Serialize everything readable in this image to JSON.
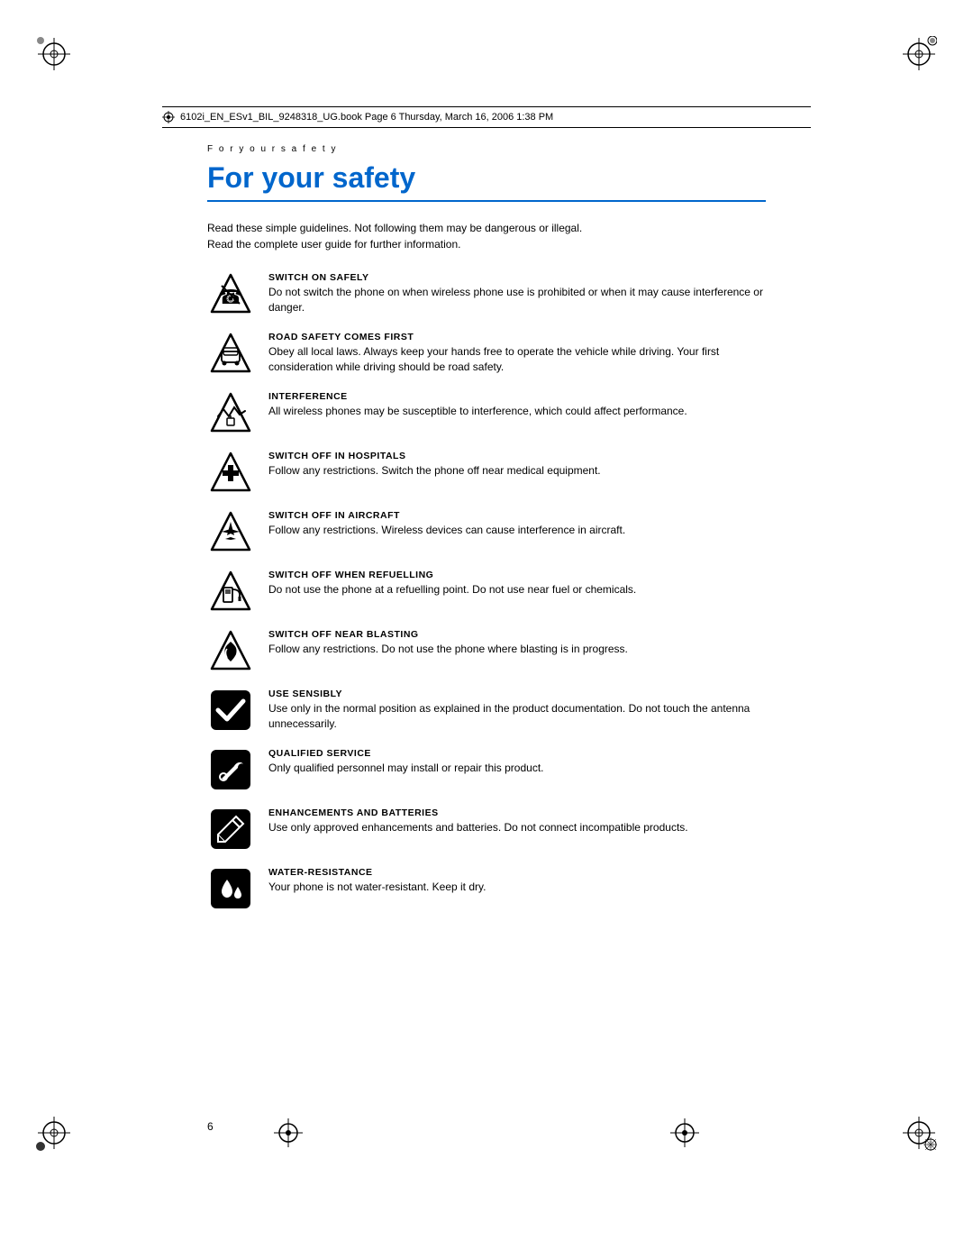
{
  "header": {
    "text": "6102i_EN_ESv1_BIL_9248318_UG.book  Page 6  Thursday, March 16, 2006  1:38 PM"
  },
  "section_label": "F o r   y o u r   s a f e t y",
  "main_heading": "For your safety",
  "intro": "Read these simple guidelines. Not following them may be dangerous or illegal.\nRead the complete user guide for further information.",
  "items": [
    {
      "title": "SWITCH ON SAFELY",
      "body": "Do not switch the phone on when wireless phone use is prohibited or when it may cause interference or danger.",
      "icon": "switch-on-safely"
    },
    {
      "title": "ROAD SAFETY COMES FIRST",
      "body": "Obey all local laws. Always keep your hands free to operate the vehicle while driving. Your first consideration while driving should be road safety.",
      "icon": "road-safety"
    },
    {
      "title": "INTERFERENCE",
      "body": "All wireless phones may be susceptible to interference, which could affect performance.",
      "icon": "interference"
    },
    {
      "title": "SWITCH OFF IN HOSPITALS",
      "body": "Follow any restrictions. Switch the phone off near medical equipment.",
      "icon": "hospitals"
    },
    {
      "title": "SWITCH OFF IN AIRCRAFT",
      "body": "Follow any restrictions. Wireless devices can cause interference in aircraft.",
      "icon": "aircraft"
    },
    {
      "title": "SWITCH OFF WHEN REFUELLING",
      "body": "Do not use the phone at a refuelling point. Do not use near fuel or chemicals.",
      "icon": "refuelling"
    },
    {
      "title": "SWITCH OFF NEAR BLASTING",
      "body": "Follow any restrictions. Do not use the phone where blasting is in progress.",
      "icon": "blasting"
    },
    {
      "title": "USE SENSIBLY",
      "body": "Use only in the normal position as explained in the product documentation. Do not touch the antenna unnecessarily.",
      "icon": "use-sensibly"
    },
    {
      "title": "QUALIFIED SERVICE",
      "body": "Only qualified personnel may install or repair this product.",
      "icon": "qualified-service"
    },
    {
      "title": "ENHANCEMENTS AND BATTERIES",
      "body": "Use only approved enhancements and batteries. Do not connect incompatible products.",
      "icon": "enhancements"
    },
    {
      "title": "WATER-RESISTANCE",
      "body": "Your phone is not water-resistant. Keep it dry.",
      "icon": "water-resistance"
    }
  ],
  "page_number": "6"
}
